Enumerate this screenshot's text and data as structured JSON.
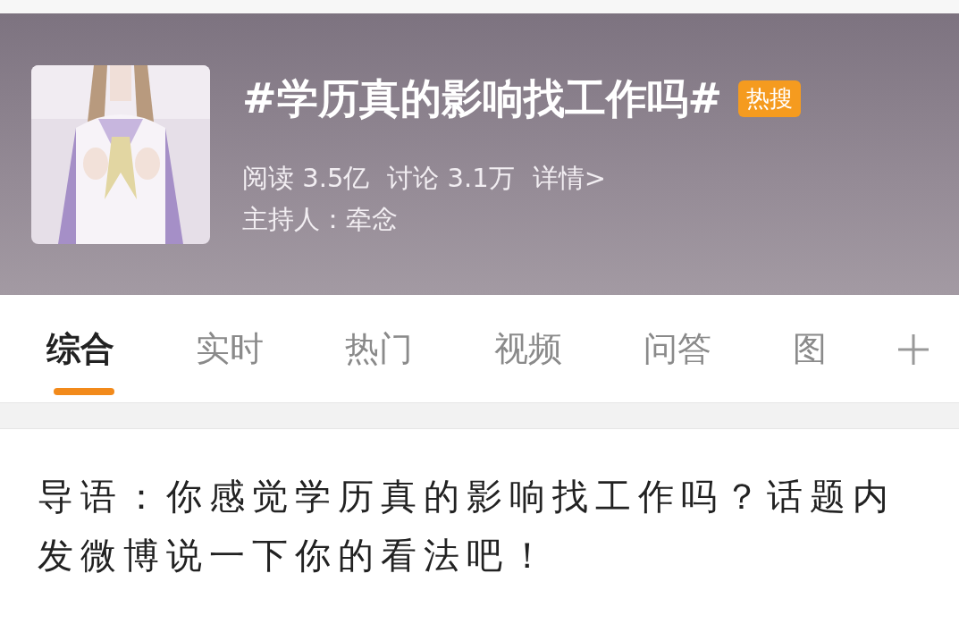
{
  "topic": {
    "title": "#学历真的影响找工作吗#",
    "badge": "热搜",
    "stats": [
      "阅读 3.5亿",
      "讨论 3.1万"
    ],
    "detail_link": "详情>",
    "host": "主持人：牵念"
  },
  "tabs": [
    {
      "label": "综合",
      "selected": true
    },
    {
      "label": "实时",
      "selected": false
    },
    {
      "label": "热门",
      "selected": false
    },
    {
      "label": "视频",
      "selected": false
    },
    {
      "label": "问答",
      "selected": false
    },
    {
      "label": "图",
      "selected": false
    }
  ],
  "intro": "导语：你感觉学历真的影响找工作吗？话题内发微博说一下你的看法吧！"
}
